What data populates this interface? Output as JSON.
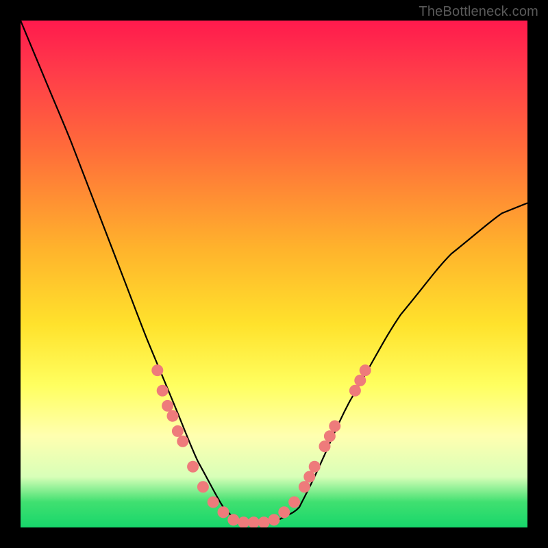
{
  "attribution": "TheBottleneck.com",
  "accent_dot_color": "#ee7b7b",
  "curve_stroke": "#000000",
  "gradient_stops": [
    {
      "pct": 0,
      "color": "#ff1a4d"
    },
    {
      "pct": 10,
      "color": "#ff3b4a"
    },
    {
      "pct": 25,
      "color": "#ff6b3a"
    },
    {
      "pct": 45,
      "color": "#ffb32c"
    },
    {
      "pct": 60,
      "color": "#ffe22c"
    },
    {
      "pct": 72,
      "color": "#ffff60"
    },
    {
      "pct": 82,
      "color": "#ffffb0"
    },
    {
      "pct": 90,
      "color": "#d8ffb8"
    },
    {
      "pct": 95,
      "color": "#40e070"
    },
    {
      "pct": 100,
      "color": "#17d66b"
    }
  ],
  "chart_data": {
    "type": "line",
    "title": "",
    "xlabel": "",
    "ylabel": "",
    "xlim": [
      0,
      100
    ],
    "ylim": [
      0,
      100
    ],
    "note": "Values estimated from pixel positions; y=0 is bottom (optimal), y=100 is top (worst bottleneck).",
    "series": [
      {
        "name": "bottleneck-curve",
        "x": [
          0,
          5,
          10,
          15,
          20,
          25,
          30,
          35,
          40,
          43,
          45,
          50,
          55,
          58,
          65,
          75,
          85,
          95,
          100
        ],
        "y": [
          100,
          88,
          76,
          63,
          50,
          37,
          25,
          13,
          4,
          1,
          1,
          1,
          4,
          10,
          25,
          42,
          54,
          62,
          64
        ]
      }
    ],
    "markers": [
      {
        "x": 27,
        "y": 31
      },
      {
        "x": 28,
        "y": 27
      },
      {
        "x": 29,
        "y": 24
      },
      {
        "x": 30,
        "y": 22
      },
      {
        "x": 31,
        "y": 19
      },
      {
        "x": 32,
        "y": 17
      },
      {
        "x": 34,
        "y": 12
      },
      {
        "x": 36,
        "y": 8
      },
      {
        "x": 38,
        "y": 5
      },
      {
        "x": 40,
        "y": 3
      },
      {
        "x": 42,
        "y": 1.5
      },
      {
        "x": 44,
        "y": 1
      },
      {
        "x": 46,
        "y": 1
      },
      {
        "x": 48,
        "y": 1
      },
      {
        "x": 50,
        "y": 1.5
      },
      {
        "x": 52,
        "y": 3
      },
      {
        "x": 54,
        "y": 5
      },
      {
        "x": 56,
        "y": 8
      },
      {
        "x": 57,
        "y": 10
      },
      {
        "x": 58,
        "y": 12
      },
      {
        "x": 60,
        "y": 16
      },
      {
        "x": 61,
        "y": 18
      },
      {
        "x": 62,
        "y": 20
      },
      {
        "x": 66,
        "y": 27
      },
      {
        "x": 67,
        "y": 29
      },
      {
        "x": 68,
        "y": 31
      }
    ]
  }
}
